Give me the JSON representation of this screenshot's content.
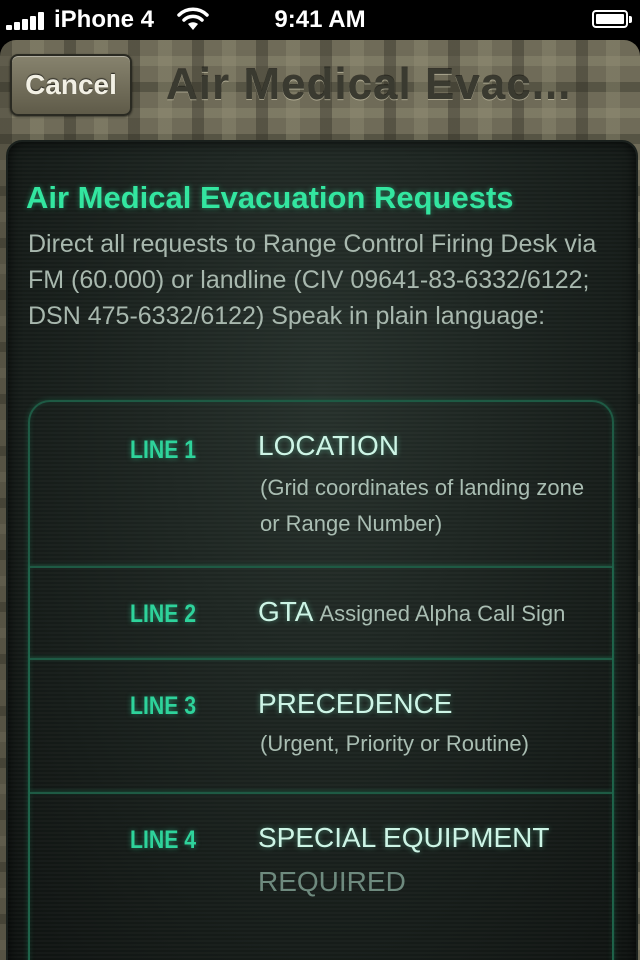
{
  "status_bar": {
    "carrier": "iPhone 4",
    "time": "9:41 AM"
  },
  "navbar": {
    "cancel_label": "Cancel",
    "title": "Air Medical Evac..."
  },
  "content": {
    "heading": "Air Medical Evacuation Requests",
    "intro": "Direct all requests to Range Control Firing Desk via FM (60.000) or landline (CIV 09641-83-6332/6122; DSN 475-6332/6122) Speak in plain language:",
    "lines": [
      {
        "label": "LINE 1",
        "title": "LOCATION",
        "detail": "(Grid coordinates of landing zone or Range Number)"
      },
      {
        "label": "LINE 2",
        "title": "GTA",
        "detail": "Assigned Alpha Call Sign"
      },
      {
        "label": "LINE 3",
        "title": "PRECEDENCE",
        "detail": "(Urgent, Priority or Routine)"
      },
      {
        "label": "LINE 4",
        "title": "SPECIAL EQUIPMENT",
        "title2": "REQUIRED"
      }
    ]
  }
}
